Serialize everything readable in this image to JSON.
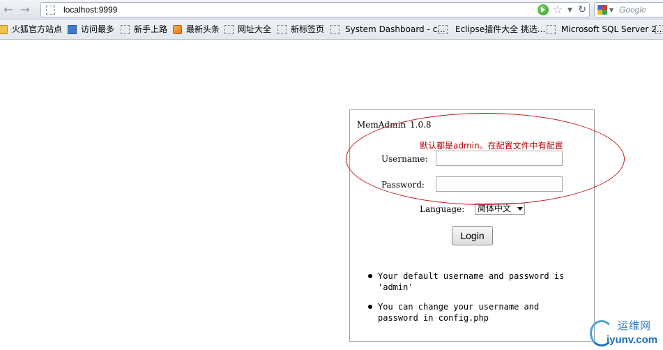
{
  "browser": {
    "url": "localhost:9999",
    "search_placeholder": "Google",
    "icons": {
      "back": "back-arrow-icon",
      "forward": "forward-arrow-icon",
      "go": "go-arrow-icon",
      "bookmark_star": "star-icon",
      "reload": "reload-icon"
    }
  },
  "bookmarks": [
    {
      "label": "火狐官方站点",
      "icon": "folder"
    },
    {
      "label": "访问最多",
      "icon": "search"
    },
    {
      "label": "新手上路",
      "icon": "page"
    },
    {
      "label": "最新头条",
      "icon": "feed"
    },
    {
      "label": "网址大全",
      "icon": "page"
    },
    {
      "label": "新标签页",
      "icon": "page"
    },
    {
      "label": "System Dashboard - c...",
      "icon": "page"
    },
    {
      "label": "Eclipse插件大全 挑选...",
      "icon": "page"
    },
    {
      "label": "Microsoft SQL Server 2...",
      "icon": "page"
    }
  ],
  "login": {
    "app_name": "MemAdmin",
    "version": "1.0.8",
    "hint": "默认都是admin。在配置文件中有配置",
    "username_label": "Username:",
    "username_value": "",
    "password_label": "Password:",
    "password_value": "",
    "language_label": "Language:",
    "language_selected": "简体中文",
    "login_button": "Login",
    "notes": [
      "Your default username and password is 'admin'",
      "You can change your username and password in config.php"
    ]
  },
  "annotation_color": "#c01818",
  "watermark": {
    "text_cn": "运维网",
    "url": "iyunv.com"
  }
}
